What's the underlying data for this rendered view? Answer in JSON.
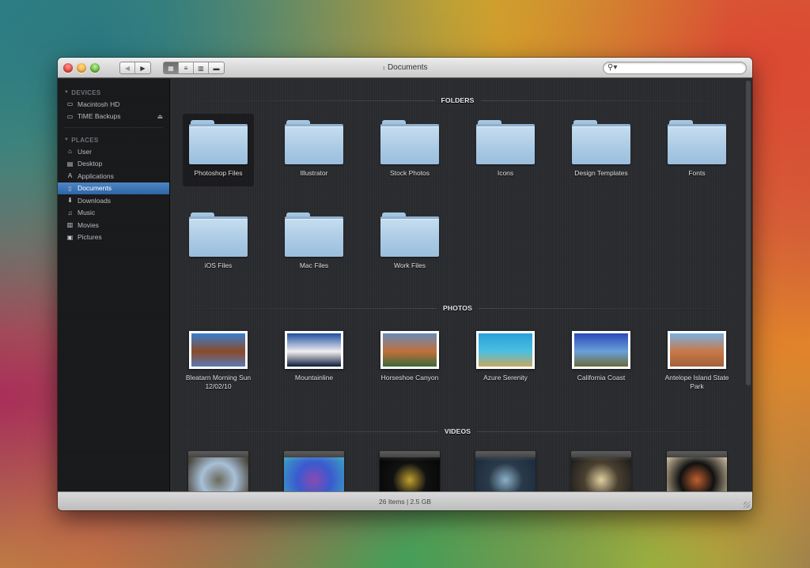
{
  "window": {
    "title": "Documents",
    "title_icon": "up-down-arrows",
    "controls": [
      "close",
      "minimize",
      "zoom"
    ]
  },
  "toolbar": {
    "back_icon": "◀",
    "forward_icon": "▶",
    "views": [
      {
        "name": "icon-view",
        "glyph": "▦",
        "active": true
      },
      {
        "name": "list-view",
        "glyph": "≡",
        "active": false
      },
      {
        "name": "column-view",
        "glyph": "▥",
        "active": false
      },
      {
        "name": "coverflow-view",
        "glyph": "▬",
        "active": false
      }
    ],
    "search": {
      "icon": "🔍︎",
      "placeholder": "",
      "value": ""
    }
  },
  "sidebar": {
    "sections": [
      {
        "title": "DEVICES",
        "items": [
          {
            "label": "Macintosh HD",
            "icon": "hard-drive",
            "glyph": "▭"
          },
          {
            "label": "TiME Backups",
            "icon": "external-drive",
            "glyph": "▭",
            "eject": "⏏"
          }
        ]
      },
      {
        "title": "PLACES",
        "items": [
          {
            "label": "User",
            "icon": "home",
            "glyph": "⌂"
          },
          {
            "label": "Desktop",
            "icon": "desktop",
            "glyph": "▤"
          },
          {
            "label": "Applications",
            "icon": "applications",
            "glyph": "A"
          },
          {
            "label": "Documents",
            "icon": "documents",
            "glyph": "▯",
            "selected": true
          },
          {
            "label": "Downloads",
            "icon": "downloads",
            "glyph": "⬇"
          },
          {
            "label": "Music",
            "icon": "music",
            "glyph": "♫"
          },
          {
            "label": "Movies",
            "icon": "movies",
            "glyph": "▥"
          },
          {
            "label": "Pictures",
            "icon": "pictures",
            "glyph": "▣"
          }
        ]
      }
    ]
  },
  "content": {
    "folders": {
      "title": "FOLDERS",
      "items": [
        {
          "label": "Photoshop Files",
          "selected": true
        },
        {
          "label": "Illustrator"
        },
        {
          "label": "Stock Photos"
        },
        {
          "label": "Icons"
        },
        {
          "label": "Design Templates"
        },
        {
          "label": "Fonts"
        },
        {
          "label": "iOS Files"
        },
        {
          "label": "Mac Files"
        },
        {
          "label": "Work Files"
        }
      ]
    },
    "photos": {
      "title": "PHOTOS",
      "items": [
        {
          "label": "Bleatarn Morning Sun 12/02/10",
          "colors": [
            "#3a7fcf",
            "#8a4a2a",
            "#5a7ab5"
          ]
        },
        {
          "label": "Mountainline",
          "colors": [
            "#1e4fa0",
            "#f2eef0",
            "#0a1a3a"
          ]
        },
        {
          "label": "Horseshoe Canyon",
          "colors": [
            "#6a8ab8",
            "#c0703a",
            "#3a6a3a"
          ]
        },
        {
          "label": "Azure Serenity",
          "colors": [
            "#2aa0d8",
            "#4ac0e0",
            "#c8a860"
          ]
        },
        {
          "label": "California Coast",
          "colors": [
            "#2a4ab8",
            "#6aa0d8",
            "#6a6a3a"
          ]
        },
        {
          "label": "Antelope Island State Park",
          "colors": [
            "#7ab0e0",
            "#c87848",
            "#a0603a"
          ]
        }
      ]
    },
    "videos": {
      "title": "VIDEOS",
      "items": [
        {
          "label": "",
          "colors": [
            "#a8c0d8",
            "#6a6a5a",
            "#3a3020"
          ]
        },
        {
          "label": "",
          "colors": [
            "#3a5ad0",
            "#8a4ab0",
            "#3aa0c0"
          ]
        },
        {
          "label": "",
          "colors": [
            "#111111",
            "#c0a030",
            "#050505"
          ]
        },
        {
          "label": "",
          "colors": [
            "#2a3a4a",
            "#8ab0c8",
            "#1a2a3a"
          ]
        },
        {
          "label": "",
          "colors": [
            "#4a4030",
            "#e0d0a0",
            "#1a1a1a"
          ]
        },
        {
          "label": "",
          "colors": [
            "#111111",
            "#c06030",
            "#d0c0a0"
          ]
        }
      ]
    }
  },
  "status": {
    "text": "26 Items | 2.5 GB"
  }
}
